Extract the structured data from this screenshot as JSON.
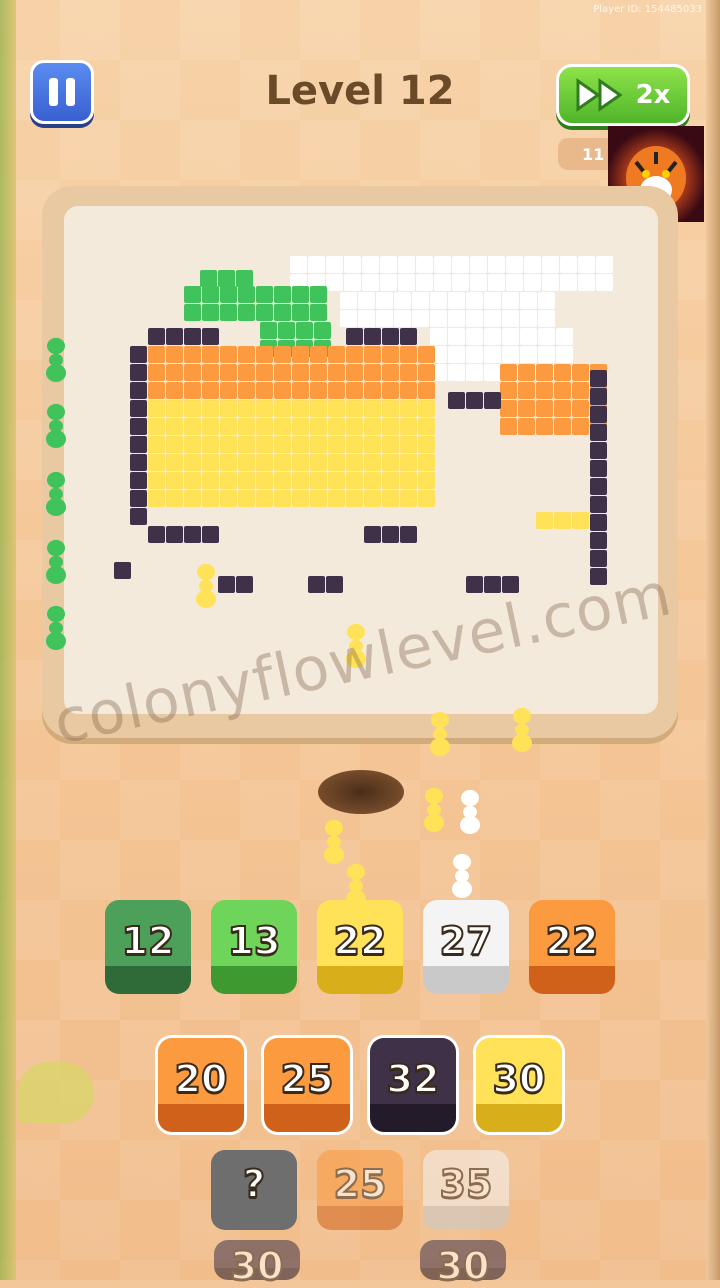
{
  "header": {
    "player_id": "Player ID: 154485033",
    "level_title": "Level 12",
    "speed_label": "2x",
    "timer_text": "11"
  },
  "icons": {
    "pause": "pause-icon",
    "fast_forward": "fast-forward-icon",
    "avatar": "tiger-avatar-icon"
  },
  "colors": {
    "orange": "#fb9a3e",
    "yellow": "#ffe257",
    "green": "#3fc35a",
    "dark": "#3f3248",
    "white": "#ffffff"
  },
  "watermark": "colonyflowlevel.com",
  "queue": {
    "row1": [
      {
        "value": "12",
        "color": "darkgreen"
      },
      {
        "value": "13",
        "color": "green"
      },
      {
        "value": "22",
        "color": "yellow"
      },
      {
        "value": "27",
        "color": "white"
      },
      {
        "value": "22",
        "color": "orange"
      }
    ],
    "row2": [
      {
        "value": "20",
        "color": "orange"
      },
      {
        "value": "25",
        "color": "orange"
      },
      {
        "value": "32",
        "color": "dark"
      },
      {
        "value": "30",
        "color": "yellow"
      }
    ],
    "row3": [
      {
        "value": "?",
        "color": "gray"
      },
      {
        "value": "25",
        "color": "orange"
      },
      {
        "value": "35",
        "color": "white"
      }
    ],
    "row4": [
      {
        "value": "30",
        "color": "dark"
      },
      {
        "value": "30",
        "color": "dark"
      }
    ]
  }
}
